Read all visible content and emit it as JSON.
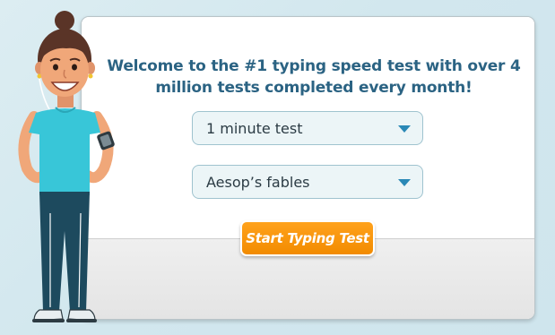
{
  "welcome": {
    "message": "Welcome to the #1 typing speed test with over 4 million tests completed every month!"
  },
  "test_options": {
    "duration": {
      "selected": "1 minute test"
    },
    "text_source": {
      "selected": "Aesop’s fables"
    }
  },
  "start_button": {
    "label": "Start Typing Test"
  },
  "colors": {
    "heading": "#2b6383",
    "dropdown_bg": "#ecf5f7",
    "dropdown_arrow": "#2a88b6",
    "button": "#f28b00",
    "page_bg": "#d4e8ee"
  },
  "icons": {
    "dropdown": "chevron-down-icon",
    "mascot": "woman-mascot-illustration"
  }
}
